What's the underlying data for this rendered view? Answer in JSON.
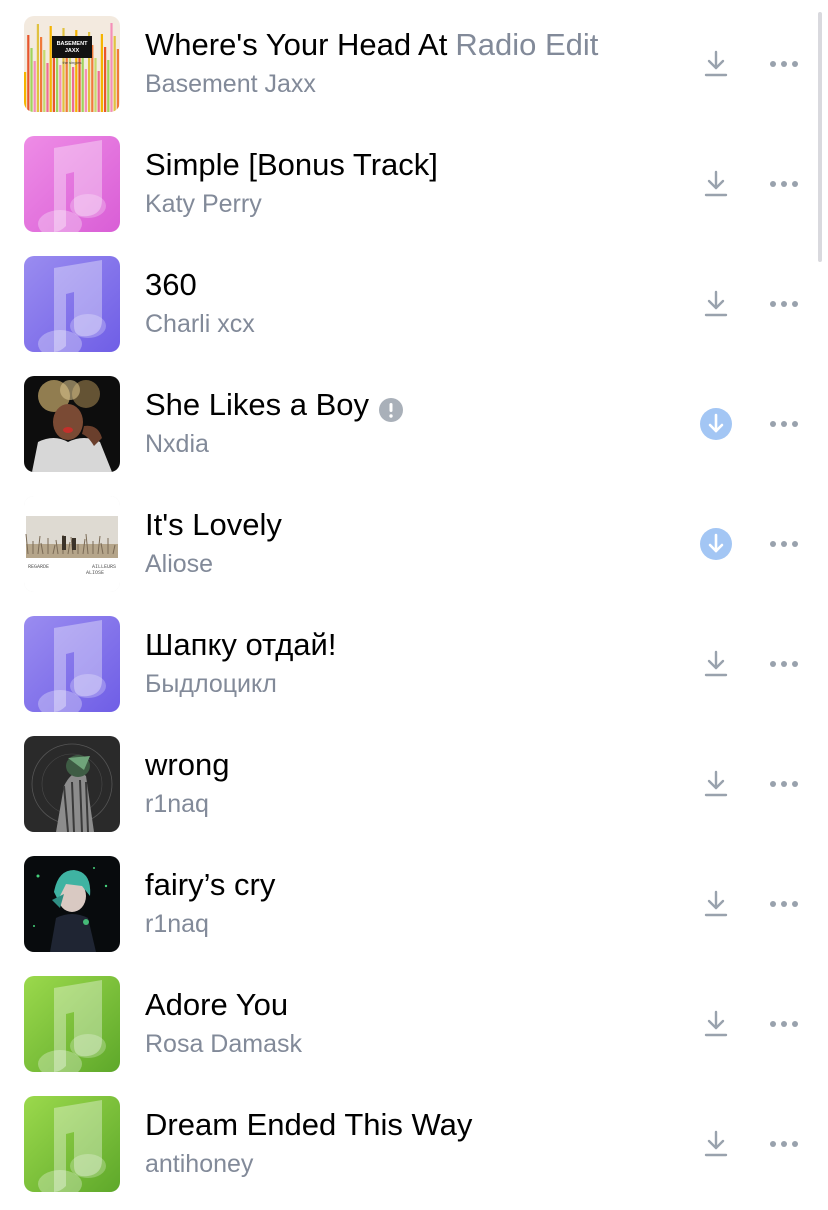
{
  "tracks": [
    {
      "title": "Where's Your Head At",
      "subtitle": "Radio Edit",
      "artist": "Basement Jaxx",
      "cover": "basement-jaxx-singles-art",
      "downloaded": false,
      "explicit": false
    },
    {
      "title": "Simple [Bonus Track]",
      "subtitle": "",
      "artist": "Katy Perry",
      "cover": "placeholder-pink",
      "downloaded": false,
      "explicit": false
    },
    {
      "title": "360",
      "subtitle": "",
      "artist": "Charli xcx",
      "cover": "placeholder-purple",
      "downloaded": false,
      "explicit": false
    },
    {
      "title": "She Likes a Boy",
      "subtitle": "",
      "artist": "Nxdia",
      "cover": "portrait-photo",
      "downloaded": true,
      "explicit": true
    },
    {
      "title": "It's Lovely",
      "subtitle": "",
      "artist": "Aliose",
      "cover": "regarde-ailleurs-art",
      "downloaded": true,
      "explicit": false
    },
    {
      "title": "Шапку отдай!",
      "subtitle": "",
      "artist": "Быдлоцикл",
      "cover": "placeholder-purple",
      "downloaded": false,
      "explicit": false
    },
    {
      "title": "wrong",
      "subtitle": "",
      "artist": "r1naq",
      "cover": "dark-illustration-gray",
      "downloaded": false,
      "explicit": false
    },
    {
      "title": "fairy’s cry",
      "subtitle": "",
      "artist": "r1naq",
      "cover": "dark-illustration-teal",
      "downloaded": false,
      "explicit": false
    },
    {
      "title": "Adore You",
      "subtitle": "",
      "artist": "Rosa Damask",
      "cover": "placeholder-green",
      "downloaded": false,
      "explicit": false
    },
    {
      "title": "Dream Ended This Way",
      "subtitle": "",
      "artist": "antihoney",
      "cover": "placeholder-green",
      "downloaded": false,
      "explicit": false
    }
  ],
  "cover_art_text": {
    "basement_jaxx": {
      "band": "BASEMENT JAXX",
      "album": "the singles"
    },
    "aliose": {
      "left": "REGARDE",
      "right": "AILLEURS",
      "bottom": "ALIOSE"
    }
  },
  "icons": {
    "download": "download-icon",
    "downloaded": "downloaded-check-icon",
    "more": "more-dots-icon",
    "explicit": "exclamation-badge-icon"
  },
  "colors": {
    "title": "#000000",
    "secondary": "#828a99",
    "icon": "#99a2ad",
    "accent_downloaded": "#a3c6f4",
    "pink": "#e67ae6",
    "purple": "#7d6ae8",
    "green": "#72c233"
  }
}
